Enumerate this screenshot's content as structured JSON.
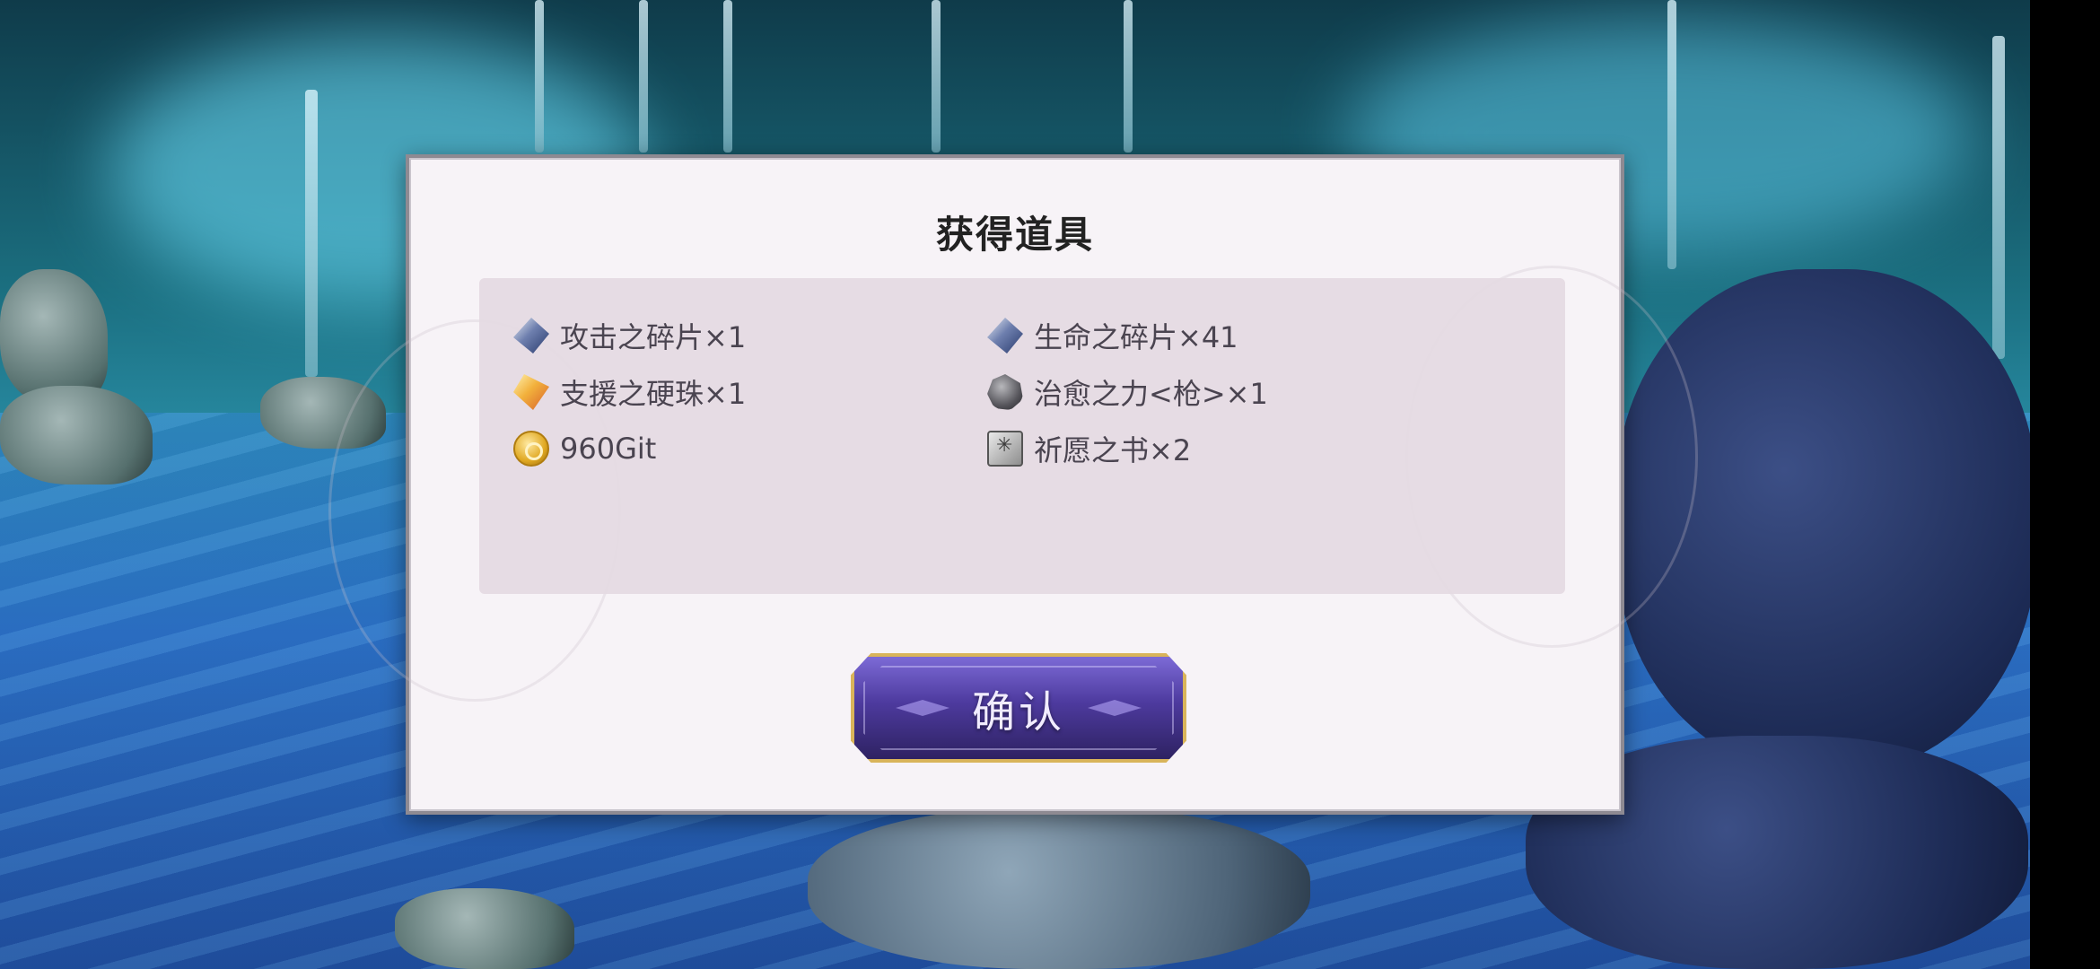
{
  "dialog": {
    "title": "获得道具",
    "items": [
      {
        "icon": "attack-shard-icon",
        "label": "攻击之碎片×1"
      },
      {
        "icon": "life-shard-icon",
        "label": "生命之碎片×41"
      },
      {
        "icon": "support-orb-icon",
        "label": "支援之硬珠×1"
      },
      {
        "icon": "healing-power-icon",
        "label": "治愈之力<枪>×1"
      },
      {
        "icon": "git-coin-icon",
        "label": "960Git"
      },
      {
        "icon": "prayer-book-icon",
        "label": "祈愿之书×2"
      }
    ],
    "confirm_label": "确认"
  },
  "colors": {
    "dialog_bg": "#f7f3f7",
    "panel_bg": "#e4dae2",
    "button_border": "#d9b45a",
    "button_fill": "#4d3a9e"
  }
}
